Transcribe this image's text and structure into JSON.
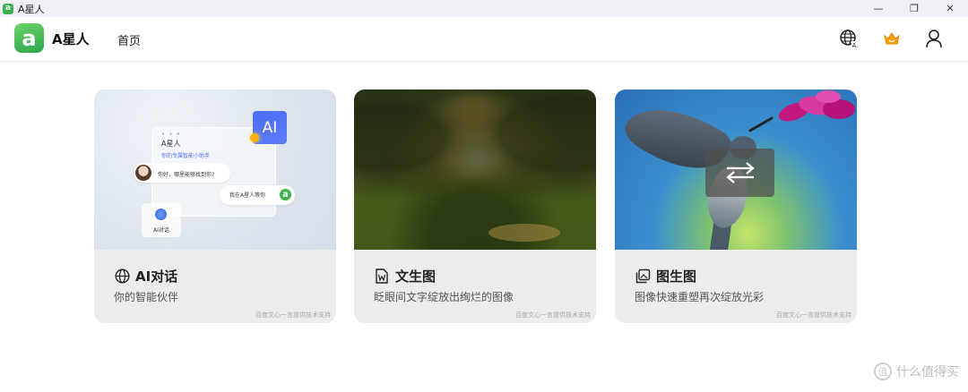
{
  "window": {
    "title": "A星人",
    "logo_letter": "a",
    "controls": {
      "minimize": "—",
      "restore": "❐",
      "close": "✕"
    }
  },
  "header": {
    "app_name": "A星人",
    "logo_letter": "a",
    "nav": [
      {
        "label": "首页"
      }
    ],
    "icons": [
      "globe-language-icon",
      "crown-icon",
      "user-icon"
    ],
    "accent_color": "#37b24d"
  },
  "cards": [
    {
      "title": "AI对话",
      "subtitle": "你的智能伙伴",
      "footer": "百度文心一言提供技术支持",
      "icon": "globe-icon",
      "illustration": {
        "assistant_name": "A星人",
        "assistant_desc": "你的专属智能小助手",
        "user_message": "你好，哪里能够找到你?",
        "bot_reply": "我在A星人等你",
        "mini_card_label": "AI对话",
        "badge_text": "AI",
        "dots": "• • •",
        "avatar_letter": "a"
      }
    },
    {
      "title": "文生图",
      "subtitle": "眨眼间文字绽放出绚烂的图像",
      "footer": "百度文心一言提供技术支持",
      "icon": "document-w-icon"
    },
    {
      "title": "图生图",
      "subtitle": "图像快速重塑再次绽放光彩",
      "footer": "百度文心一言提供技术支持",
      "icon": "image-copy-icon",
      "overlay_icon": "⇄"
    }
  ],
  "watermark": {
    "text": "什么值得买",
    "icon_glyph": "值"
  }
}
